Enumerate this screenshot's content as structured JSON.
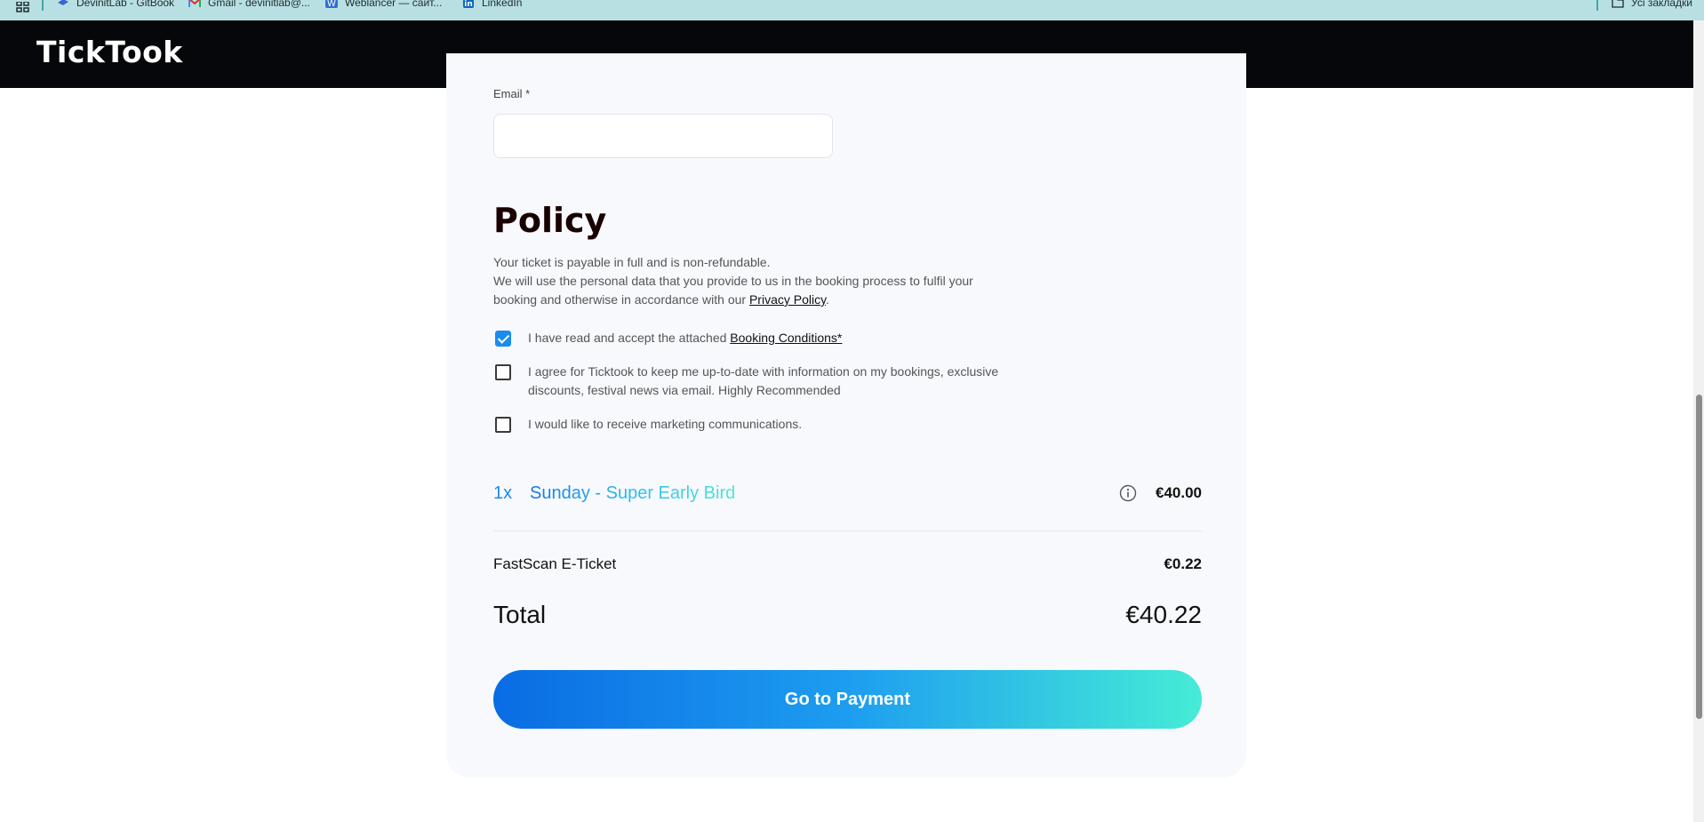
{
  "bookmarks": {
    "items": [
      {
        "label": "DevinitLab - GitBook",
        "icon": "gitbook-icon"
      },
      {
        "label": "Gmail - devinitlab@...",
        "icon": "gmail-icon"
      },
      {
        "label": "Weblancer — сайт...",
        "icon": "weblancer-icon"
      },
      {
        "label": "LinkedIn",
        "icon": "linkedin-icon"
      }
    ],
    "all_bookmarks_label": "Усі закладки"
  },
  "header": {
    "logo": "TickTook"
  },
  "form": {
    "email_label": "Email *",
    "email_value": "",
    "email_placeholder": ""
  },
  "policy": {
    "title": "Policy",
    "line1": "Your ticket is payable in full and is non-refundable.",
    "line2": "We will use the personal data that you provide to us in the booking process to fulfil your booking and otherwise in accordance with our ",
    "privacy_link": "Privacy Policy",
    "line2_end": ".",
    "checkboxes": [
      {
        "text": "I have read and accept the attached ",
        "link": "Booking Conditions*",
        "checked": true
      },
      {
        "text": "I agree for Ticktook to keep me up-to-date with information on my bookings, exclusive discounts, festival news via email. Highly Recommended",
        "checked": false
      },
      {
        "text": "I would like to receive marketing communications.",
        "checked": false
      }
    ]
  },
  "order": {
    "quantity": "1x",
    "ticket_name": "Sunday - Super Early Bird",
    "ticket_price": "€40.00",
    "fee_label": "FastScan E-Ticket",
    "fee_value": "€0.22",
    "total_label": "Total",
    "total_value": "€40.22"
  },
  "payment_button_label": "Go to Payment",
  "colors": {
    "accent": "#1a8cf0",
    "gradient_start": "#0a6ce3",
    "gradient_end": "#45ecd6",
    "header_bg": "#05070a",
    "card_bg": "#f7f9fd"
  }
}
